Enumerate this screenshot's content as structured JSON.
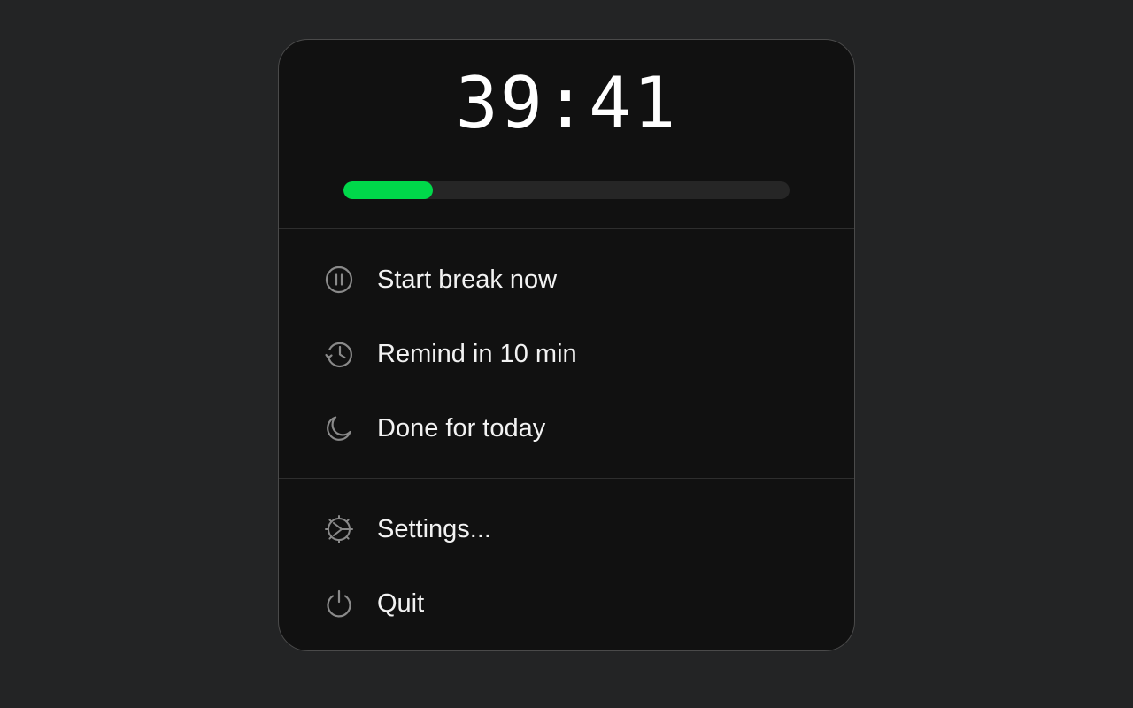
{
  "timer": {
    "display": "39:41",
    "progress_fraction": 0.2
  },
  "colors": {
    "background": "#232425",
    "panel": "#111111",
    "accent": "#00d84a",
    "text": "#f2f2f2"
  },
  "menu": {
    "primary": [
      {
        "label": "Start break now",
        "icon": "pause-circle-icon"
      },
      {
        "label": "Remind in 10 min",
        "icon": "history-icon"
      },
      {
        "label": "Done for today",
        "icon": "moon-icon"
      }
    ],
    "secondary": [
      {
        "label": "Settings...",
        "icon": "gear-icon"
      },
      {
        "label": "Quit",
        "icon": "power-icon"
      }
    ]
  }
}
